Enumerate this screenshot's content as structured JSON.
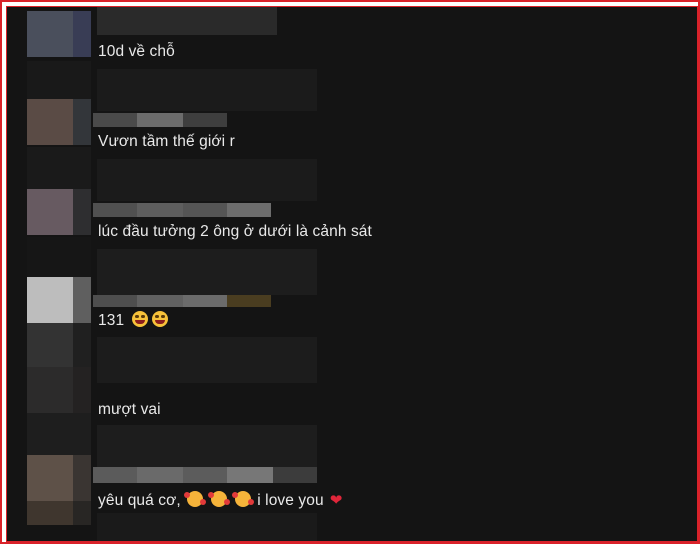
{
  "comments": [
    {
      "text": "10d về chỗ",
      "emojis": [],
      "heart": false
    },
    {
      "text": "Vươn tầm thế giới r",
      "emojis": [],
      "heart": false
    },
    {
      "text": "lúc đầu tưởng 2 ông ở dưới là cảnh sát",
      "emojis": [],
      "heart": false
    },
    {
      "text": "131",
      "emojis": [
        "laughing-emoji",
        "laughing-emoji"
      ],
      "heart": false
    },
    {
      "text": "mượt vai",
      "emojis": [],
      "heart": false
    },
    {
      "text": "yêu quá cơ,",
      "text_after": "i love you",
      "emojis": [
        "smiling-hearts-emoji",
        "smiling-hearts-emoji",
        "smiling-hearts-emoji"
      ],
      "heart": true,
      "heart_glyph": "❤"
    }
  ],
  "colors": {
    "background": "#141414",
    "text": "#e9e9e9",
    "frame": "#d9222a"
  }
}
